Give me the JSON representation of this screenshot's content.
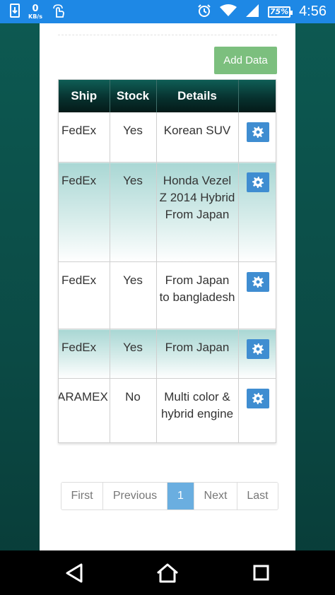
{
  "status_bar": {
    "kb_value": "0",
    "kb_unit": "KB/s",
    "battery": "75%",
    "time": "4:56",
    "icons": [
      "sim-download-icon",
      "touch-gesture-icon",
      "alarm-icon",
      "wifi-icon",
      "signal-icon",
      "battery-icon"
    ]
  },
  "toolbar": {
    "add_label": "Add Data"
  },
  "table": {
    "headers": {
      "ship": "Ship",
      "stock": "Stock",
      "details": "Details",
      "action": ""
    },
    "rows": [
      {
        "ship": "FedEx",
        "stock": "Yes",
        "details": "Korean SUV"
      },
      {
        "ship": "FedEx",
        "stock": "Yes",
        "details": "Honda Vezel Z 2014 Hybrid From Japan"
      },
      {
        "ship": "FedEx",
        "stock": "Yes",
        "details": "From Japan to bangladesh"
      },
      {
        "ship": "FedEx",
        "stock": "Yes",
        "details": "From Japan"
      },
      {
        "ship": "ARAMEX",
        "stock": "No",
        "details": "Multi color & hybrid engine"
      }
    ]
  },
  "pagination": {
    "first": "First",
    "previous": "Previous",
    "current": "1",
    "next": "Next",
    "last": "Last"
  },
  "colors": {
    "status_bar": "#1e88e5",
    "add_button": "#7cbf7e",
    "header_dark": "#041a18",
    "gear_button": "#3f8dd1",
    "active_page": "#6aaee0",
    "row_shade": "#a9d7d4"
  }
}
